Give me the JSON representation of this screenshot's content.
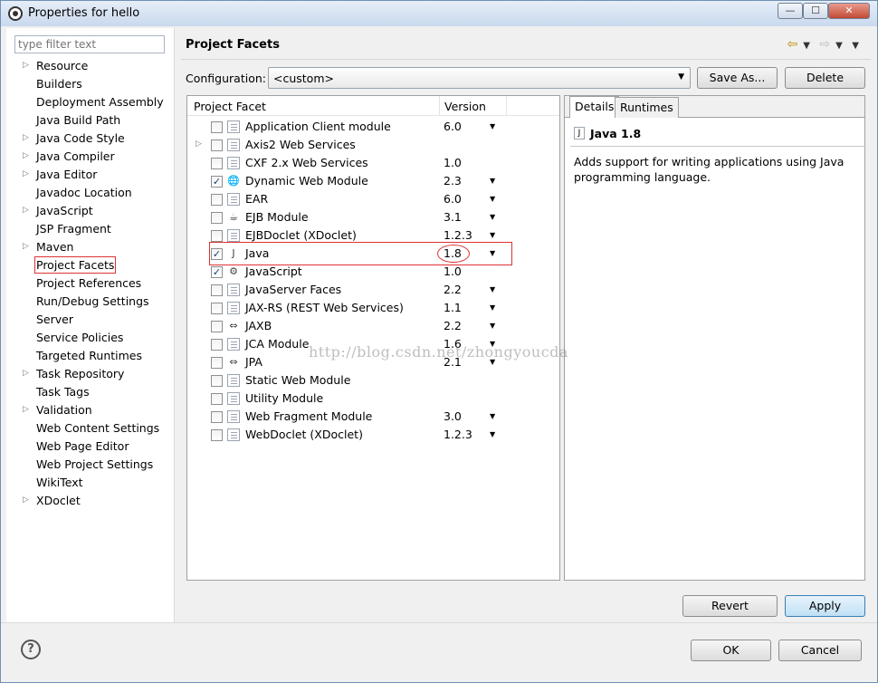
{
  "window": {
    "title": "Properties for hello",
    "min_glyph": "—",
    "max_glyph": "☐",
    "close_glyph": "✕"
  },
  "sidebar": {
    "filter_placeholder": "type filter text",
    "items": [
      {
        "label": "Resource",
        "expandable": true
      },
      {
        "label": "Builders",
        "expandable": false
      },
      {
        "label": "Deployment Assembly",
        "expandable": false
      },
      {
        "label": "Java Build Path",
        "expandable": false
      },
      {
        "label": "Java Code Style",
        "expandable": true
      },
      {
        "label": "Java Compiler",
        "expandable": true
      },
      {
        "label": "Java Editor",
        "expandable": true
      },
      {
        "label": "Javadoc Location",
        "expandable": false
      },
      {
        "label": "JavaScript",
        "expandable": true
      },
      {
        "label": "JSP Fragment",
        "expandable": false
      },
      {
        "label": "Maven",
        "expandable": true
      },
      {
        "label": "Project Facets",
        "expandable": false,
        "selected": true
      },
      {
        "label": "Project References",
        "expandable": false
      },
      {
        "label": "Run/Debug Settings",
        "expandable": false
      },
      {
        "label": "Server",
        "expandable": false
      },
      {
        "label": "Service Policies",
        "expandable": false
      },
      {
        "label": "Targeted Runtimes",
        "expandable": false
      },
      {
        "label": "Task Repository",
        "expandable": true
      },
      {
        "label": "Task Tags",
        "expandable": false
      },
      {
        "label": "Validation",
        "expandable": true
      },
      {
        "label": "Web Content Settings",
        "expandable": false
      },
      {
        "label": "Web Page Editor",
        "expandable": false
      },
      {
        "label": "Web Project Settings",
        "expandable": false
      },
      {
        "label": "WikiText",
        "expandable": false
      },
      {
        "label": "XDoclet",
        "expandable": true
      }
    ]
  },
  "main": {
    "title": "Project Facets",
    "config_label": "Configuration:",
    "config_value": "<custom>",
    "save_as": "Save As...",
    "delete": "Delete",
    "facets_header": {
      "facet": "Project Facet",
      "version": "Version"
    },
    "facets": [
      {
        "name": "Application Client module",
        "version": "6.0",
        "checked": false,
        "dropdown": true,
        "expand": false,
        "icon": "doc"
      },
      {
        "name": "Axis2 Web Services",
        "version": "",
        "checked": false,
        "dropdown": false,
        "expand": true,
        "icon": "doc"
      },
      {
        "name": "CXF 2.x Web Services",
        "version": "1.0",
        "checked": false,
        "dropdown": false,
        "expand": false,
        "icon": "doc"
      },
      {
        "name": "Dynamic Web Module",
        "version": "2.3",
        "checked": true,
        "dropdown": true,
        "expand": false,
        "icon": "web"
      },
      {
        "name": "EAR",
        "version": "6.0",
        "checked": false,
        "dropdown": true,
        "expand": false,
        "icon": "doc"
      },
      {
        "name": "EJB Module",
        "version": "3.1",
        "checked": false,
        "dropdown": true,
        "expand": false,
        "icon": "bean"
      },
      {
        "name": "EJBDoclet (XDoclet)",
        "version": "1.2.3",
        "checked": false,
        "dropdown": true,
        "expand": false,
        "icon": "doc"
      },
      {
        "name": "Java",
        "version": "1.8",
        "checked": true,
        "dropdown": true,
        "expand": false,
        "icon": "java"
      },
      {
        "name": "JavaScript",
        "version": "1.0",
        "checked": true,
        "dropdown": false,
        "expand": false,
        "icon": "js"
      },
      {
        "name": "JavaServer Faces",
        "version": "2.2",
        "checked": false,
        "dropdown": true,
        "expand": false,
        "icon": "doc"
      },
      {
        "name": "JAX-RS (REST Web Services)",
        "version": "1.1",
        "checked": false,
        "dropdown": true,
        "expand": false,
        "icon": "doc"
      },
      {
        "name": "JAXB",
        "version": "2.2",
        "checked": false,
        "dropdown": true,
        "expand": false,
        "icon": "xml"
      },
      {
        "name": "JCA Module",
        "version": "1.6",
        "checked": false,
        "dropdown": true,
        "expand": false,
        "icon": "doc"
      },
      {
        "name": "JPA",
        "version": "2.1",
        "checked": false,
        "dropdown": true,
        "expand": false,
        "icon": "xml"
      },
      {
        "name": "Static Web Module",
        "version": "",
        "checked": false,
        "dropdown": false,
        "expand": false,
        "icon": "doc"
      },
      {
        "name": "Utility Module",
        "version": "",
        "checked": false,
        "dropdown": false,
        "expand": false,
        "icon": "doc"
      },
      {
        "name": "Web Fragment Module",
        "version": "3.0",
        "checked": false,
        "dropdown": true,
        "expand": false,
        "icon": "doc"
      },
      {
        "name": "WebDoclet (XDoclet)",
        "version": "1.2.3",
        "checked": false,
        "dropdown": true,
        "expand": false,
        "icon": "doc"
      }
    ],
    "details_tabs": [
      "Details",
      "Runtimes"
    ],
    "details_title": "Java 1.8",
    "details_desc": "Adds support for writing applications using Java programming language.",
    "revert": "Revert",
    "apply": "Apply",
    "watermark": "http://blog.csdn.net/zhongyoucda"
  },
  "footer": {
    "ok": "OK",
    "cancel": "Cancel",
    "help_glyph": "?"
  }
}
